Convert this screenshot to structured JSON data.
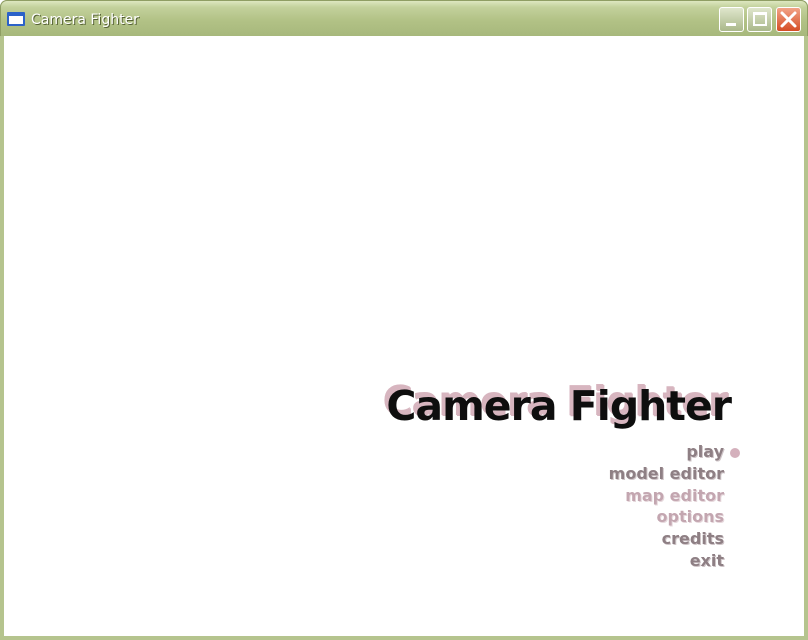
{
  "window": {
    "title": "Camera Fighter",
    "icon": "window-app-icon",
    "controls": [
      "minimize-icon",
      "maximize-icon",
      "close-icon"
    ]
  },
  "game": {
    "title": "Camera Fighter",
    "menu": {
      "items": [
        {
          "label": "play",
          "selected": true
        },
        {
          "label": "model editor"
        },
        {
          "label": "map editor",
          "dim": true
        },
        {
          "label": "options",
          "dim": true
        },
        {
          "label": "credits"
        },
        {
          "label": "exit"
        }
      ],
      "selector_icon": "selection-dot-icon"
    }
  },
  "colors": {
    "titlebar": "#b2c286",
    "title_text": "#ffffff",
    "game_title": "#0e0e0e",
    "game_title_shadow": "#d7b5bf",
    "menu_text": "#8e7f84",
    "menu_text_dim": "#c3a6b0",
    "selector_dot": "#d4b0bc",
    "close_button": "#d54d25"
  }
}
